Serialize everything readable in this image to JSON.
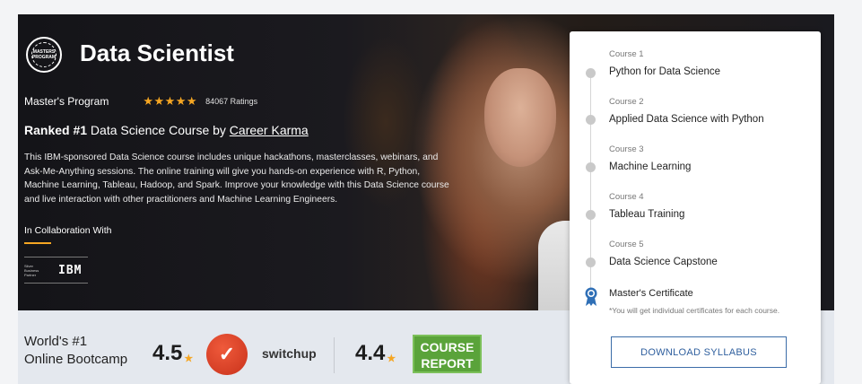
{
  "header": {
    "logo_text": "MASTERS PROGRAM",
    "title": "Data Scientist",
    "program_type": "Master's Program",
    "stars": "★★★★★",
    "ratings": "84067 Ratings"
  },
  "ranked": {
    "prefix": "Ranked #1",
    "middle": " Data Science Course by ",
    "link": "Career Karma"
  },
  "description": "This IBM-sponsored Data Science course includes unique hackathons, masterclasses, webinars, and Ask-Me-Anything sessions. The online training will give you hands-on experience with R, Python, Machine Learning, Tableau, Hadoop, and Spark. Improve your knowledge with this Data Science course and live interaction with other practitioners and Machine Learning Engineers.",
  "collaboration": {
    "label": "In Collaboration With",
    "partner_small": "Silver Business Partner",
    "partner_name": "IBM"
  },
  "bottom": {
    "line1": "World's #1",
    "line2": "Online Bootcamp",
    "switchup_score": "4.5",
    "switchup_name": "switchup",
    "course_report_score": "4.4",
    "course_report_name": "COURSE REPORT",
    "star": "★"
  },
  "courses": [
    {
      "label": "Course 1",
      "name": "Python for Data Science"
    },
    {
      "label": "Course 2",
      "name": "Applied Data Science with Python"
    },
    {
      "label": "Course 3",
      "name": "Machine Learning"
    },
    {
      "label": "Course 4",
      "name": "Tableau Training"
    },
    {
      "label": "Course 5",
      "name": "Data Science Capstone"
    }
  ],
  "certificate": {
    "title": "Master's Certificate",
    "note": "*You will get individual certificates for each course."
  },
  "download_button": "DOWNLOAD SYLLABUS",
  "colors": {
    "accent_star": "#f5a623",
    "button_border": "#3b6ca8",
    "course_report_green": "#5aa33a",
    "switchup_red": "#d63b20"
  }
}
